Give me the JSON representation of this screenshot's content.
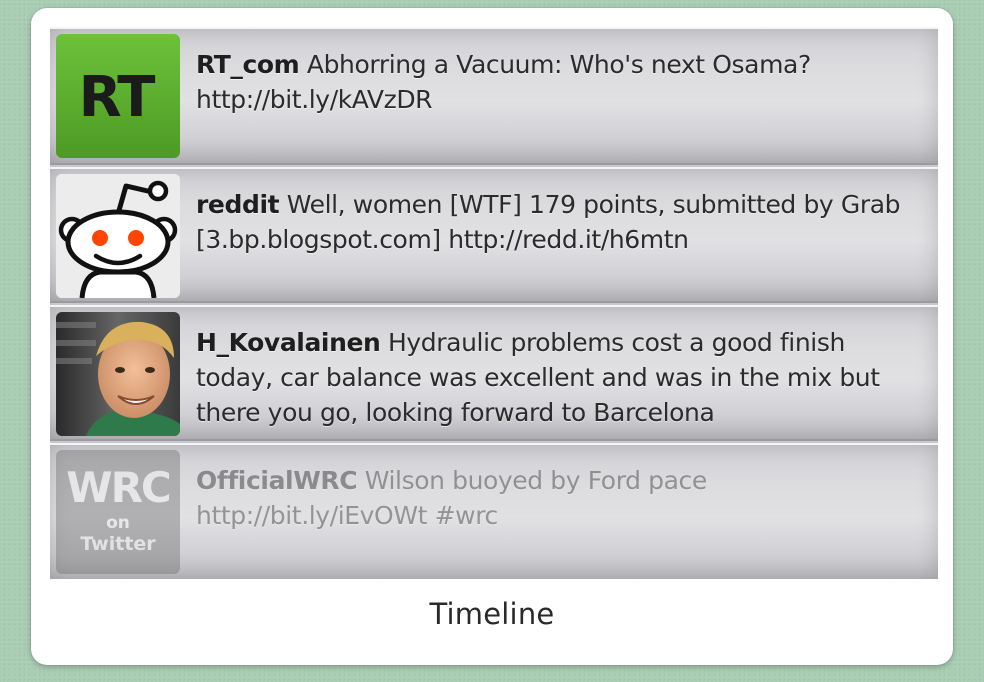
{
  "widget": {
    "label": "Timeline"
  },
  "tweets": [
    {
      "user": "RT_com",
      "text": "Abhorring a Vacuum: Who's next Osama? http://bit.ly/kAVzDR",
      "avatar_icon": "rt-logo-icon",
      "avatar_text": "RT",
      "avatar_color": "#5aaa2c"
    },
    {
      "user": "reddit",
      "text": "Well, women [WTF] 179 points, submitted by Grab [3.bp.blogspot.com] http://redd.it/h6mtn",
      "avatar_icon": "reddit-alien-icon"
    },
    {
      "user": "H_Kovalainen",
      "text": "Hydraulic problems cost a good finish today, car balance was excellent and was in the mix but there you go, looking forward to Barcelona",
      "avatar_icon": "person-photo-icon"
    },
    {
      "user": "OfficialWRC",
      "text": "Wilson buoyed by Ford pace http://bit.ly/iEvOWt #wrc",
      "avatar_icon": "wrc-logo-icon",
      "avatar_text": "WRC",
      "avatar_sub1": "on",
      "avatar_sub2": "Twitter"
    }
  ]
}
